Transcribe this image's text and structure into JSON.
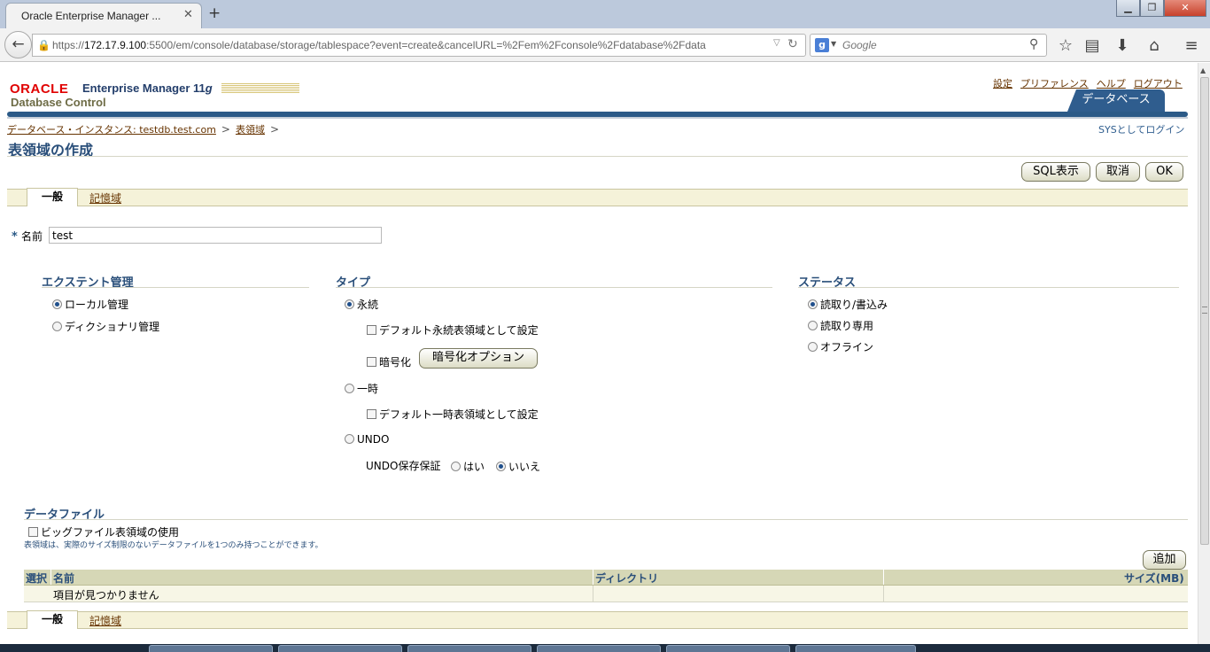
{
  "browser": {
    "tab_title": "Oracle Enterprise Manager ...",
    "url_scheme": "https://",
    "url_host": "172.17.9.100",
    "url_rest": ":5500/em/console/database/storage/tablespace?event=create&cancelURL=%2Fem%2Fconsole%2Fdatabase%2Fdata",
    "search_placeholder": "Google",
    "window_buttons": [
      "▁",
      "❐",
      "✕"
    ]
  },
  "header": {
    "logo_oracle": "ORACLE",
    "logo_em": "Enterprise Manager 11",
    "logo_em_g": "g",
    "logo_subtitle": "Database Control",
    "global_links": [
      "設定",
      "プリファレンス",
      "ヘルプ",
      "ログアウト"
    ],
    "db_tab": "データベース"
  },
  "breadcrumb": {
    "items": [
      "データベース・インスタンス: testdb.test.com",
      "表領域"
    ],
    "separator": ">"
  },
  "sys_login": "SYSとしてログイン",
  "page_title": "表領域の作成",
  "buttons": {
    "show_sql": "SQL表示",
    "cancel": "取消",
    "ok": "OK",
    "add": "追加",
    "encrypt_options": "暗号化オプション"
  },
  "subtabs": {
    "general": "一般",
    "storage": "記憶域"
  },
  "name": {
    "label": "名前",
    "required_mark": "*",
    "value": "test"
  },
  "extent": {
    "heading": "エクステント管理",
    "options": [
      "ローカル管理",
      "ディクショナリ管理"
    ],
    "selected": "ローカル管理"
  },
  "type": {
    "heading": "タイプ",
    "permanent": "永続",
    "default_permanent": "デフォルト永続表領域として設定",
    "encrypt": "暗号化",
    "temporary": "一時",
    "default_temporary": "デフォルト一時表領域として設定",
    "undo": "UNDO",
    "undo_retention": "UNDO保存保証",
    "yes": "はい",
    "no": "いいえ",
    "selected": "永続",
    "undo_selected": "いいえ"
  },
  "status": {
    "heading": "ステータス",
    "options": [
      "読取り/書込み",
      "読取り専用",
      "オフライン"
    ],
    "selected": "読取り/書込み"
  },
  "datafile": {
    "heading": "データファイル",
    "bigfile_label": "ビッグファイル表領域の使用",
    "hint": "表領域は、実際のサイズ制限のないデータファイルを1つのみ持つことができます。",
    "columns": [
      "選択",
      "名前",
      "ディレクトリ",
      "サイズ(MB)"
    ],
    "empty_message": "項目が見つかりません"
  },
  "colors": {
    "accent_blue": "#2b5a87",
    "link_brown": "#663300",
    "tab_bar": "#f5f2d9",
    "table_head": "#d6d7b6"
  }
}
